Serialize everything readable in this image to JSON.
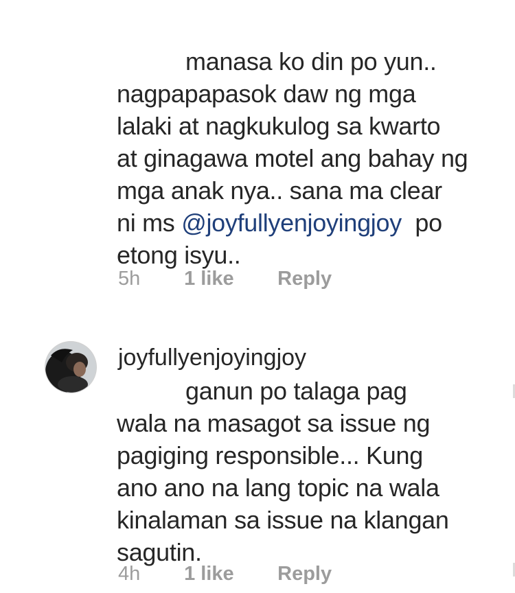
{
  "comments": [
    {
      "lines": [
        "manasa ko din po yun..",
        "nagpapapasok daw ng mga",
        "lalaki at nagkukulog sa kwarto",
        "at ginagawa motel ang bahay ng",
        "mga anak nya.. sana ma clear"
      ],
      "mention_line_prefix": "ni ms ",
      "mention": "@joyfullyenjoyingjoy",
      "mention_line_suffix": "  po",
      "last_line": "etong isyu..",
      "time": "5h",
      "likes": "1 like",
      "reply": "Reply"
    },
    {
      "username": "joyfullyenjoyingjoy",
      "avatar_icon": "profile-photo",
      "lines": [
        "ganun po talaga pag",
        "wala na masagot sa issue ng",
        "pagiging responsible... Kung",
        "ano ano na lang topic na wala",
        "kinalaman sa issue na klangan",
        "sagutin."
      ],
      "time": "4h",
      "likes": "1 like",
      "reply": "Reply"
    }
  ],
  "colors": {
    "text": "#262626",
    "mention": "#1f3f7a",
    "meta": "#9c9c9c"
  }
}
